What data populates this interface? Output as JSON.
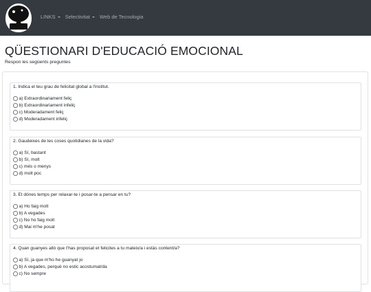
{
  "navbar": {
    "logo_text": "PARDAL GRAU",
    "links": [
      {
        "label": "LINKS",
        "dropdown": true
      },
      {
        "label": "Selectivitat",
        "dropdown": true
      },
      {
        "label": "Web de Tecnologia",
        "dropdown": false
      }
    ]
  },
  "page": {
    "title": "QÜESTIONARI D'EDUCACIÓ EMOCIONAL",
    "subtitle": "Respon les següents preguntes"
  },
  "questions": [
    {
      "text": "1. Indica el teu grau de felicitat global a l'institut.",
      "options": [
        "a) Extraordinariament feliç",
        "b) Extraordinariament infeliç",
        "c) Moderadament feliç",
        "d) Moderadament infeliç"
      ]
    },
    {
      "text": "2. Gaudeixes de les coses quotidianes de la vida?",
      "options": [
        "a) Sí, bastant",
        "b) Sí, molt",
        "c) més o menys",
        "d) molt poc"
      ]
    },
    {
      "text": "3. Et dónes temps per relaxar-te i posar-te a pensar en tu?",
      "options": [
        "a) Ho faig molt",
        "b) A vegades",
        "c) No ho faig molt",
        "d) Mai m'he posat"
      ]
    },
    {
      "text": "4. Quan guanyes allò que t'has proposat et felicites a tu mateix/a i estàs content/a?",
      "options": [
        "a) Sí, ja que m'ho he guanyat jo",
        "b) A vegades, perquè no estic acostumat/da",
        "c) No sempre"
      ]
    }
  ]
}
